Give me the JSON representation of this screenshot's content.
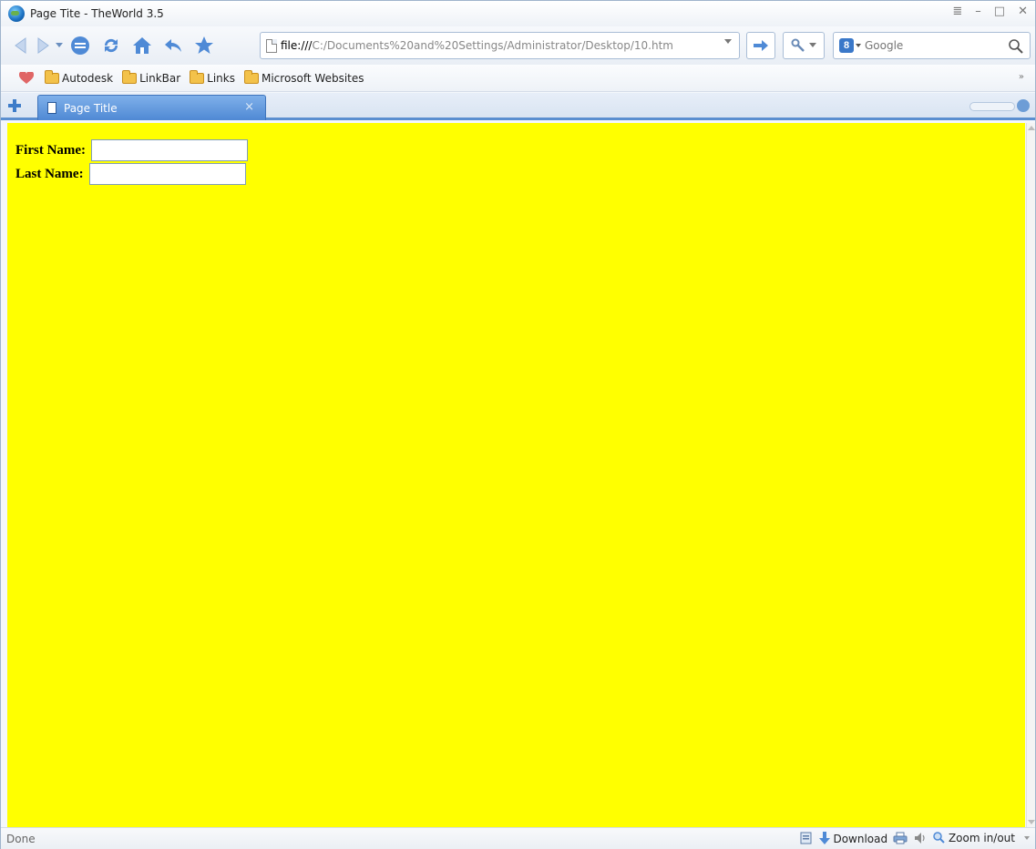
{
  "window": {
    "title": "Page Tite - TheWorld 3.5",
    "controls": {
      "menu": "≣",
      "minimize": "–",
      "maximize": "□",
      "close": "✕"
    }
  },
  "toolbar": {
    "address": {
      "scheme": "file:///",
      "path": "C:/Documents%20and%20Settings/Administrator/Desktop/10.htm"
    },
    "search": {
      "placeholder": "Google"
    }
  },
  "bookmarks": {
    "items": [
      "Autodesk",
      "LinkBar",
      "Links",
      "Microsoft Websites"
    ],
    "more": "»"
  },
  "tabs": [
    {
      "label": "Page Title",
      "close": "×"
    }
  ],
  "content": {
    "background": "#ffff00",
    "form": {
      "first_name_label": "First Name:",
      "first_name_value": "",
      "last_name_label": "Last Name:",
      "last_name_value": ""
    }
  },
  "statusbar": {
    "status": "Done",
    "download_label": "Download",
    "zoom_label": "Zoom in/out"
  },
  "icons": [
    "back-icon",
    "forward-icon",
    "stop-icon",
    "refresh-icon",
    "home-icon",
    "undo-icon",
    "favorites-icon"
  ]
}
